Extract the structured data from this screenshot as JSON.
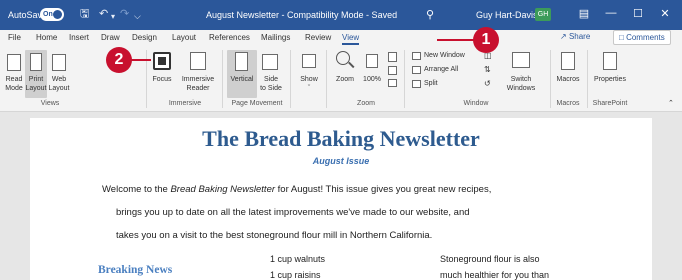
{
  "titlebar": {
    "autosave": "AutoSave",
    "toggle": "On",
    "doc_title": "August Newsletter - Compatibility Mode - Saved",
    "user_name": "Guy Hart-Davis",
    "user_initials": "GH",
    "save_icon": "save-icon",
    "undo_icon": "undo-icon",
    "redo_icon": "redo-icon",
    "search_icon": "search-icon"
  },
  "menu": [
    "File",
    "Home",
    "Insert",
    "Draw",
    "Design",
    "Layout",
    "References",
    "Mailings",
    "Review",
    "View"
  ],
  "menu_active": "View",
  "share_label": "Share",
  "comments_label": "Comments",
  "ribbon": {
    "views": {
      "read_mode": [
        "Read",
        "Mode"
      ],
      "print_layout": [
        "Print",
        "Layout"
      ],
      "web_layout": [
        "Web",
        "Layout"
      ],
      "group": "Views"
    },
    "immersive": {
      "focus": "Focus",
      "immersive_reader": [
        "Immersive",
        "Reader"
      ],
      "group": "Immersive"
    },
    "page_movement": {
      "vertical": "Vertical",
      "side_to_side": [
        "Side",
        "to Side"
      ],
      "group": "Page Movement"
    },
    "show": "Show",
    "zoom": {
      "zoom": "Zoom",
      "percent": "100%",
      "group": "Zoom"
    },
    "window": {
      "new_window": "New Window",
      "arrange_all": "Arrange All",
      "split": "Split",
      "switch_windows": [
        "Switch",
        "Windows"
      ],
      "group": "Window"
    },
    "macros": {
      "label": "Macros",
      "group": "Macros"
    },
    "sharepoint": {
      "properties": "Properties",
      "group": "SharePoint"
    }
  },
  "callouts": [
    "1",
    "2"
  ],
  "doc": {
    "heading": "The Bread Baking Newsletter",
    "subheading": "August Issue",
    "para_line1_pre": "Welcome to the ",
    "para_line1_em": "Bread Baking Newsletter",
    "para_line1_post": " for August! This issue gives you great new recipes,",
    "para_line2": "brings you up to date on all the latest improvements we've made to our website, and",
    "para_line3": "takes you on a visit to the best stoneground flour mill in Northern California.",
    "breaking_news": "Breaking News",
    "ingredients": [
      "1 cup walnuts",
      "1 cup raisins"
    ],
    "aside": [
      "Stoneground flour is also",
      "much healthier for you than"
    ]
  },
  "colors": {
    "titlebar": "#2b579a",
    "heading": "#2e5b8f",
    "callout": "#c8102e"
  }
}
